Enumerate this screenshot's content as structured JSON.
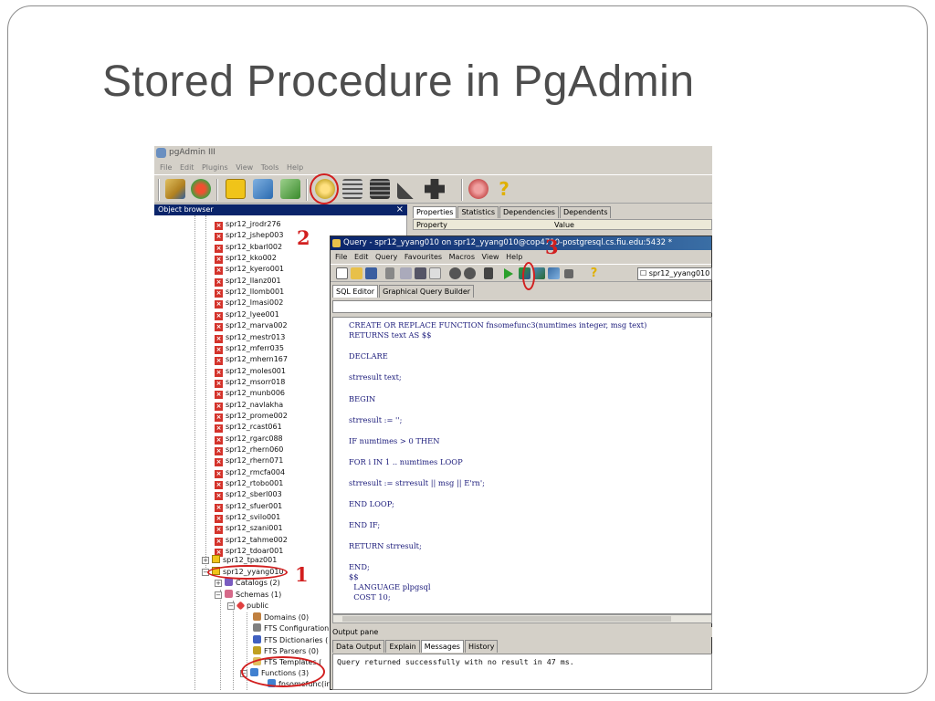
{
  "slide": {
    "title": "Stored Procedure in PgAdmin"
  },
  "main_window": {
    "title": "pgAdmin III",
    "menu": [
      "File",
      "Edit",
      "Plugins",
      "View",
      "Tools",
      "Help"
    ],
    "toolbar_icons": [
      "connect-icon",
      "refresh-icon",
      "properties-icon",
      "create-object-icon",
      "drop-object-icon",
      "sql-query-icon",
      "view-data-icon",
      "filtered-data-icon",
      "maintenance-icon",
      "plugins-icon",
      "guru-hint-icon",
      "help-icon"
    ]
  },
  "object_browser": {
    "header": "Object browser",
    "close": "×",
    "servers": [
      "spr12_jrodr276",
      "spr12_jshep003",
      "spr12_kbarl002",
      "spr12_kko002",
      "spr12_kyero001",
      "spr12_llanz001",
      "spr12_llomb001",
      "spr12_lmasi002",
      "spr12_lyee001",
      "spr12_marva002",
      "spr12_mestr013",
      "spr12_mferr035",
      "spr12_mhern167",
      "spr12_moles001",
      "spr12_msorr018",
      "spr12_munb006",
      "spr12_navlakha",
      "spr12_prome002",
      "spr12_rcast061",
      "spr12_rgarc088",
      "spr12_rhern060",
      "spr12_rhern071",
      "spr12_rmcfa004",
      "spr12_rtobo001",
      "spr12_sberl003",
      "spr12_sfuer001",
      "spr12_svilo001",
      "spr12_szani001",
      "spr12_tahme002",
      "spr12_tdoar001"
    ],
    "db_tpaz": "spr12_tpaz001",
    "db_yyang": "spr12_yyang010",
    "catalogs": "Catalogs (2)",
    "schemas": "Schemas (1)",
    "public": "public",
    "domains": "Domains (0)",
    "fts_configurations": "FTS Configuration",
    "fts_dictionaries": "FTS Dictionaries (",
    "fts_parsers": "FTS Parsers (0)",
    "fts_templates": "FTS Templates (",
    "functions": "Functions (3)",
    "fnsomefunc": "fnsomefunc(ir"
  },
  "properties": {
    "tabs": [
      "Properties",
      "Statistics",
      "Dependencies",
      "Dependents"
    ],
    "col_property": "Property",
    "col_value": "Value"
  },
  "query_window": {
    "title": "Query - spr12_yyang010 on spr12_yyang010@cop4710-postgresql.cs.fiu.edu:5432 *",
    "menu": [
      "File",
      "Edit",
      "Query",
      "Favourites",
      "Macros",
      "View",
      "Help"
    ],
    "db_select": "spr12_yyang010 c",
    "tabs": [
      "SQL Editor",
      "Graphical Query Builder"
    ],
    "code": [
      "CREATE OR REPLACE FUNCTION fnsomefunc3(numtimes integer, msg text)",
      "RETURNS text AS $$",
      "DECLARE",
      "strresult text;",
      "BEGIN",
      "strresult := '';",
      "IF numtimes > 0 THEN",
      "FOR i IN 1 .. numtimes LOOP",
      "strresult := strresult || msg || E'rn';",
      "END LOOP;",
      "END IF;",
      "RETURN strresult;",
      "END;",
      "$$",
      "  LANGUAGE plpgsql",
      "  COST 10;"
    ],
    "output_label": "Output pane",
    "output_tabs": [
      "Data Output",
      "Explain",
      "Messages",
      "History"
    ],
    "output_message": "Query returned successfully with no result in 47 ms."
  },
  "annotations": {
    "one": "1",
    "two": "2",
    "three": "3",
    "color": "#d21f1f"
  }
}
